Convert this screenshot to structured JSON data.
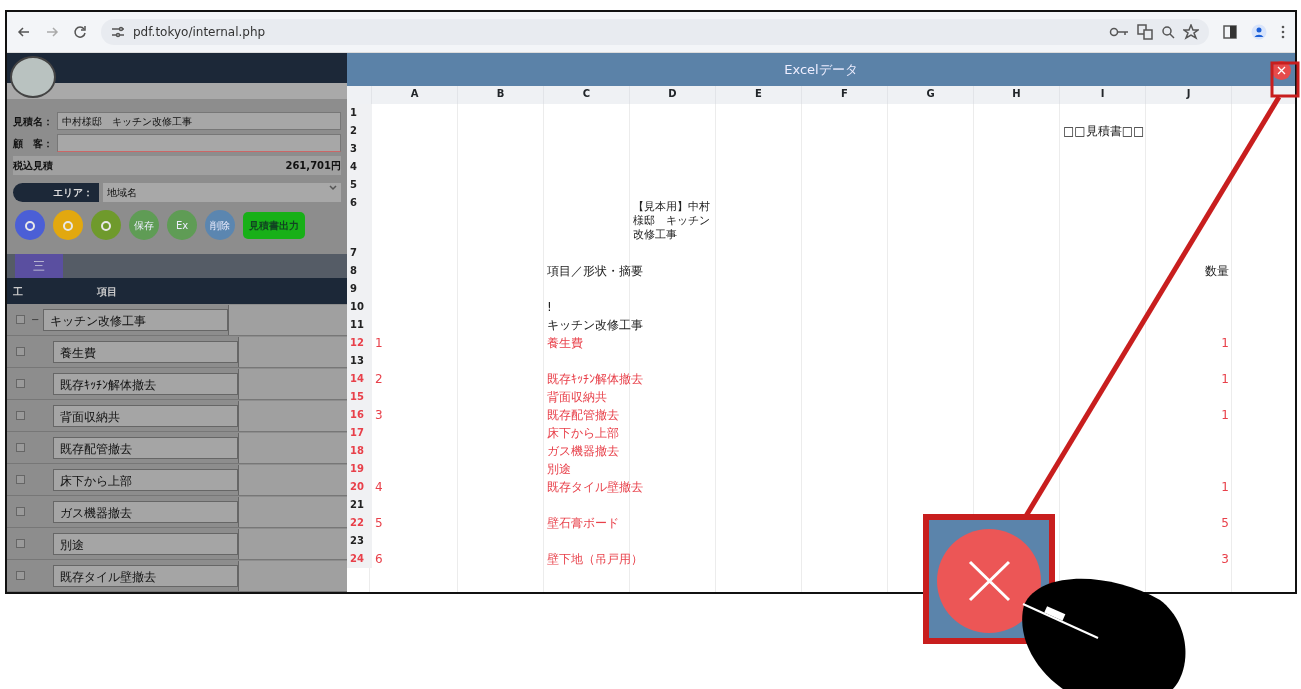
{
  "browser": {
    "url": "pdf.tokyo/internal.php"
  },
  "app": {
    "estimate_name": {
      "label": "見積名：",
      "value": "中村様邸　キッチン改修工事"
    },
    "customer": {
      "label": "顧　客："
    },
    "total": {
      "label": "税込見積",
      "amount": "261,701円"
    },
    "area": {
      "label": "エリア：",
      "value": "地域名"
    },
    "action_buttons": [
      {
        "kind": "icon",
        "color": "#4b5fd6"
      },
      {
        "kind": "icon",
        "color": "#e2a80f"
      },
      {
        "kind": "icon",
        "color": "#6f9a2c"
      },
      {
        "kind": "text",
        "label": "保存",
        "color": "#5f9c55"
      },
      {
        "kind": "text",
        "label": "Ex",
        "color": "#5f9c55"
      },
      {
        "kind": "text",
        "label": "削除",
        "color": "#5b86b0"
      },
      {
        "kind": "wide",
        "label": "見積書出力",
        "color": "#18b018"
      }
    ],
    "tabs": [
      {
        "label": "三",
        "selected": true
      }
    ],
    "table": {
      "columns": [
        "工",
        "項目"
      ],
      "rows": [
        {
          "item": "キッチン改修工事",
          "toggle": "−",
          "checked": false,
          "expanded": true,
          "children": [
            {
              "item": "養生費",
              "checked": false
            },
            {
              "item": "既存ｷｯﾁﾝ解体撤去",
              "checked": false
            },
            {
              "item": "背面収納共",
              "checked": false
            },
            {
              "item": "既存配管撤去",
              "checked": false
            },
            {
              "item": "床下から上部",
              "checked": false
            },
            {
              "item": "ガス機器撤去",
              "checked": false
            },
            {
              "item": "別途",
              "checked": false
            },
            {
              "item": "既存タイル壁撤去",
              "checked": false
            }
          ]
        }
      ]
    }
  },
  "modal": {
    "title": "Excelデータ",
    "columns": [
      "A",
      "B",
      "C",
      "D",
      "E",
      "F",
      "G",
      "H",
      "I",
      "J"
    ],
    "rows": [
      {
        "number": "1",
        "highlight": false,
        "cells": {}
      },
      {
        "number": "2",
        "highlight": false,
        "cells": {
          "I": "□□見積書□□"
        }
      },
      {
        "number": "3",
        "highlight": false,
        "cells": {}
      },
      {
        "number": "4",
        "highlight": false,
        "cells": {}
      },
      {
        "number": "5",
        "highlight": false,
        "cells": {}
      },
      {
        "number": "6",
        "highlight": false,
        "wrap": true,
        "cells": {
          "D": "【見本用】中村様邸　キッチン改修工事"
        }
      },
      {
        "number": "7",
        "highlight": false,
        "cells": {}
      },
      {
        "number": "8",
        "highlight": false,
        "cells": {
          "C": "項目／形状・摘要",
          "J": "数量"
        }
      },
      {
        "number": "9",
        "highlight": false,
        "cells": {}
      },
      {
        "number": "10",
        "highlight": false,
        "cells": {
          "C": "!"
        }
      },
      {
        "number": "11",
        "highlight": false,
        "cells": {
          "C": "キッチン改修工事"
        }
      },
      {
        "number": "12",
        "highlight": true,
        "cells": {
          "A": "1",
          "C": "養生費",
          "J": "1"
        }
      },
      {
        "number": "13",
        "highlight": false,
        "cells": {}
      },
      {
        "number": "14",
        "highlight": true,
        "cells": {
          "A": "2",
          "C": "既存ｷｯﾁﾝ解体撤去",
          "J": "1"
        }
      },
      {
        "number": "15",
        "highlight": true,
        "cells": {
          "C": "背面収納共"
        }
      },
      {
        "number": "16",
        "highlight": true,
        "cells": {
          "A": "3",
          "C": "既存配管撤去",
          "J": "1"
        }
      },
      {
        "number": "17",
        "highlight": true,
        "cells": {
          "C": "床下から上部"
        }
      },
      {
        "number": "18",
        "highlight": true,
        "cells": {
          "C": "ガス機器撤去"
        }
      },
      {
        "number": "19",
        "highlight": true,
        "cells": {
          "C": "別途"
        }
      },
      {
        "number": "20",
        "highlight": true,
        "cells": {
          "A": "4",
          "C": "既存タイル壁撤去",
          "J": "1"
        }
      },
      {
        "number": "21",
        "highlight": false,
        "cells": {}
      },
      {
        "number": "22",
        "highlight": true,
        "cells": {
          "A": "5",
          "C": "壁石膏ボード",
          "J": "5"
        }
      },
      {
        "number": "23",
        "highlight": false,
        "cells": {}
      },
      {
        "number": "24",
        "highlight": true,
        "cells": {
          "A": "6",
          "C": "壁下地（吊戸用）",
          "J": "3"
        }
      }
    ]
  }
}
